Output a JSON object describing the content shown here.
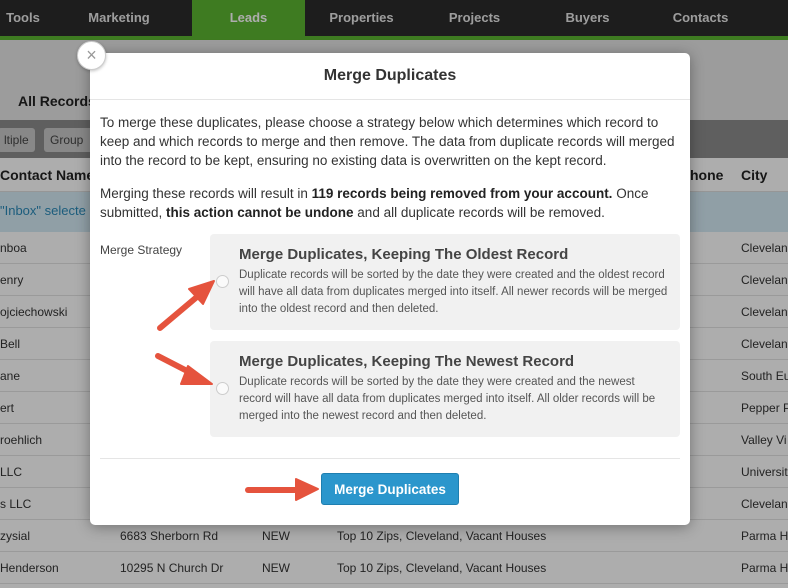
{
  "nav": {
    "items": [
      {
        "label": "Tools",
        "active": false
      },
      {
        "label": "Marketing",
        "active": false
      },
      {
        "label": "Leads",
        "active": true
      },
      {
        "label": "Properties",
        "active": false
      },
      {
        "label": "Projects",
        "active": false
      },
      {
        "label": "Buyers",
        "active": false
      },
      {
        "label": "Contacts",
        "active": false
      }
    ]
  },
  "background": {
    "all_records": "All Records",
    "buttons": [
      "ltiple",
      "Group"
    ],
    "columns": {
      "contact_name": "Contact Name",
      "phone": "hone",
      "city": "City"
    },
    "selection_text": "\"Inbox\" selecte",
    "rows": [
      {
        "name": "nboa",
        "address": "",
        "status": "",
        "tags": "",
        "city": "Clevelan"
      },
      {
        "name": "enry",
        "address": "",
        "status": "",
        "tags": "",
        "city": "Clevelan"
      },
      {
        "name": "ojciechowski",
        "address": "",
        "status": "",
        "tags": "",
        "city": "Clevelan"
      },
      {
        "name": "Bell",
        "address": "",
        "status": "",
        "tags": "",
        "city": "Clevelan"
      },
      {
        "name": "ane",
        "address": "",
        "status": "",
        "tags": "",
        "city": "South Eu"
      },
      {
        "name": "ert",
        "address": "",
        "status": "",
        "tags": "",
        "city": "Pepper P"
      },
      {
        "name": "roehlich",
        "address": "",
        "status": "",
        "tags": "",
        "city": "Valley Vi"
      },
      {
        "name": "LLC",
        "address": "",
        "status": "",
        "tags": "",
        "city": "Universit"
      },
      {
        "name": "s LLC",
        "address": "",
        "status": "",
        "tags": "",
        "city": "Clevelan"
      },
      {
        "name": "zysial",
        "address": "6683 Sherborn Rd",
        "status": "NEW",
        "tags": "Top 10 Zips, Cleveland, Vacant Houses",
        "city": "Parma H"
      },
      {
        "name": "Henderson",
        "address": "10295 N Church Dr",
        "status": "NEW",
        "tags": "Top 10 Zips, Cleveland, Vacant Houses",
        "city": "Parma H"
      }
    ]
  },
  "modal": {
    "title": "Merge Duplicates",
    "close_glyph": "×",
    "intro": "To merge these duplicates, please choose a strategy below which determines which record to keep and which records to merge and then remove. The data from duplicate records will merged into the record to be kept, ensuring no existing data is overwritten on the kept record.",
    "warning_pre": "Merging these records will result in ",
    "warning_bold1": "119 records being removed from your account.",
    "warning_mid": " Once submitted, ",
    "warning_bold2": "this action cannot be undone",
    "warning_post": " and all duplicate records will be removed.",
    "strategy_label": "Merge Strategy",
    "options": [
      {
        "title": "Merge Duplicates, Keeping The Oldest Record",
        "description": "Duplicate records will be sorted by the date they were created and the oldest record will have all data from duplicates merged into itself. All newer records will be merged into the oldest record and then deleted."
      },
      {
        "title": "Merge Duplicates, Keeping The Newest Record",
        "description": "Duplicate records will be sorted by the date they were created and the newest record will have all data from duplicates merged into itself. All older records will be merged into the newest record and then deleted."
      }
    ],
    "submit_label": "Merge Duplicates"
  },
  "colors": {
    "nav_bg": "#2b2b2b",
    "accent_green": "#5cb531",
    "button_blue": "#2b96cc",
    "arrow_red": "#e5533d"
  }
}
